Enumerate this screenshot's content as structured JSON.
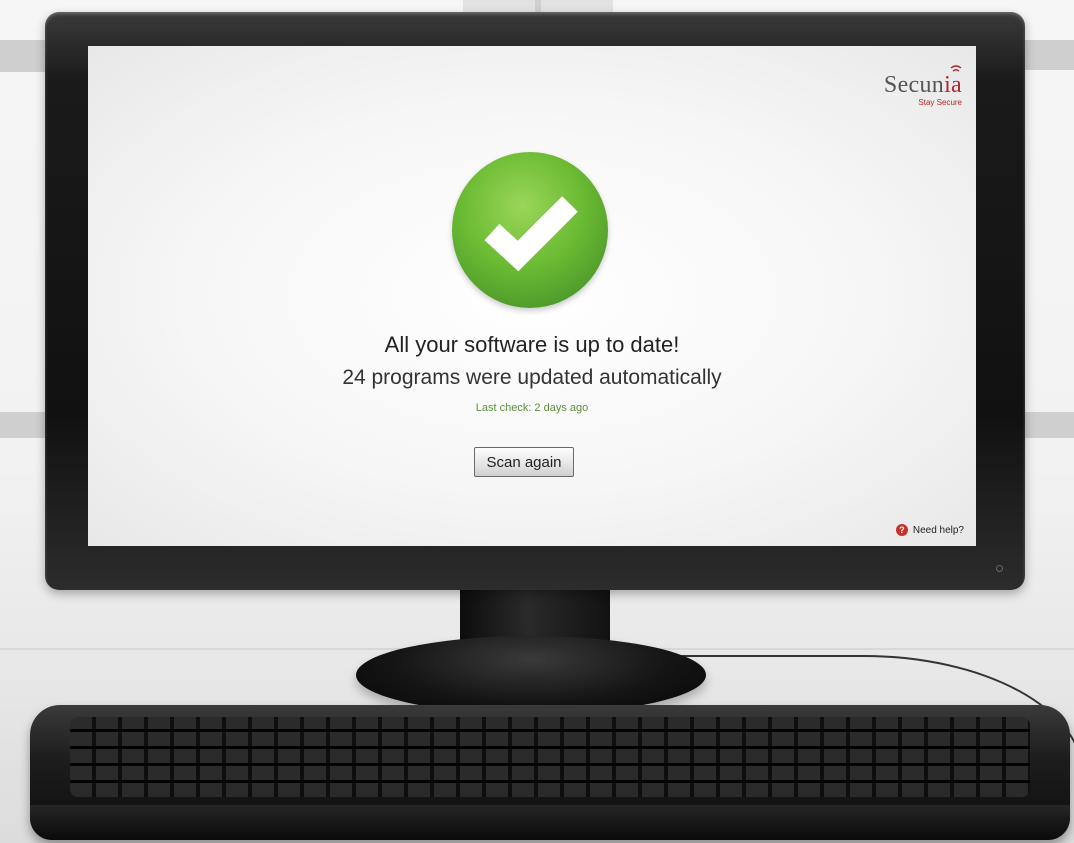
{
  "brand": {
    "name_prefix": "Secun",
    "name_suffix": "ia",
    "tagline": "Stay Secure",
    "color": "#b3262a"
  },
  "status": {
    "icon": "checkmark-icon",
    "color": "#6cbb33",
    "headline": "All your software is up to date!",
    "summary": "24 programs were updated automatically",
    "last_check": "Last check: 2 days ago"
  },
  "actions": {
    "scan_label": "Scan again"
  },
  "help": {
    "icon": "help-icon",
    "icon_glyph": "?",
    "label": "Need help?"
  }
}
